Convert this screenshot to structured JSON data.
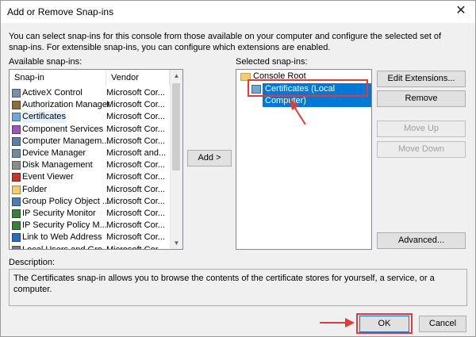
{
  "window": {
    "title": "Add or Remove Snap-ins",
    "close_glyph": "✕"
  },
  "intro": "You can select snap-ins for this console from those available on your computer and configure the selected set of snap-ins. For extensible snap-ins, you can configure which extensions are enabled.",
  "available": {
    "label": "Available snap-ins:",
    "columns": [
      "Snap-in",
      "Vendor"
    ],
    "rows": [
      {
        "name": "ActiveX Control",
        "vendor": "Microsoft Cor...",
        "icon": "activex-icon"
      },
      {
        "name": "Authorization Manager",
        "vendor": "Microsoft Cor...",
        "icon": "authorization-icon"
      },
      {
        "name": "Certificates",
        "vendor": "Microsoft Cor...",
        "icon": "certificate-icon"
      },
      {
        "name": "Component Services",
        "vendor": "Microsoft Cor...",
        "icon": "component-icon"
      },
      {
        "name": "Computer Managem...",
        "vendor": "Microsoft Cor...",
        "icon": "computer-icon"
      },
      {
        "name": "Device Manager",
        "vendor": "Microsoft and...",
        "icon": "device-icon"
      },
      {
        "name": "Disk Management",
        "vendor": "Microsoft Cor...",
        "icon": "disk-icon"
      },
      {
        "name": "Event Viewer",
        "vendor": "Microsoft Cor...",
        "icon": "event-icon"
      },
      {
        "name": "Folder",
        "vendor": "Microsoft Cor...",
        "icon": "folder-icon"
      },
      {
        "name": "Group Policy Object ...",
        "vendor": "Microsoft Cor...",
        "icon": "gpo-icon"
      },
      {
        "name": "IP Security Monitor",
        "vendor": "Microsoft Cor...",
        "icon": "ipsec-icon"
      },
      {
        "name": "IP Security Policy M...",
        "vendor": "Microsoft Cor...",
        "icon": "ipsec-policy-icon"
      },
      {
        "name": "Link to Web Address",
        "vendor": "Microsoft Cor...",
        "icon": "link-icon"
      },
      {
        "name": "Local Users and Gro...",
        "vendor": "Microsoft Cor...",
        "icon": "users-icon"
      }
    ]
  },
  "add_button": "Add >",
  "selected": {
    "label": "Selected snap-ins:",
    "root": "Console Root",
    "child": "Certificates (Local Computer)"
  },
  "buttons": {
    "edit_extensions": "Edit Extensions...",
    "remove": "Remove",
    "move_up": "Move Up",
    "move_down": "Move Down",
    "advanced": "Advanced..."
  },
  "description": {
    "label": "Description:",
    "text": "The Certificates snap-in allows you to browse the contents of the certificate stores for yourself, a service, or a computer."
  },
  "footer": {
    "ok": "OK",
    "cancel": "Cancel"
  },
  "colors": {
    "highlight": "#e53935",
    "selection": "#0078d7"
  }
}
